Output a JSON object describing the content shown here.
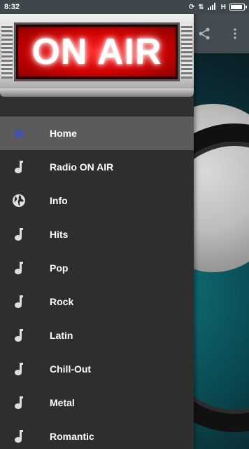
{
  "status_bar": {
    "time": "8:32",
    "network": "H",
    "battery_level": 0.95
  },
  "drawer": {
    "header_sign_text": "ON AIR",
    "items": [
      {
        "label": "Home",
        "icon": "home-icon",
        "active": true
      },
      {
        "label": "Radio ON AIR",
        "icon": "music-note-icon"
      },
      {
        "label": "Info",
        "icon": "globe-icon"
      },
      {
        "label": "Hits",
        "icon": "music-note-icon"
      },
      {
        "label": "Pop",
        "icon": "music-note-icon"
      },
      {
        "label": "Rock",
        "icon": "music-note-icon"
      },
      {
        "label": "Latin",
        "icon": "music-note-icon"
      },
      {
        "label": "Chill-Out",
        "icon": "music-note-icon"
      },
      {
        "label": "Metal",
        "icon": "music-note-icon"
      },
      {
        "label": "Romantic",
        "icon": "music-note-icon"
      }
    ]
  },
  "toolbar": {
    "icons": [
      "share-icon",
      "more-vert-icon"
    ]
  },
  "colors": {
    "drawer_bg": "#2e2e2e",
    "active_item_bg": "#5b5b5b",
    "home_icon": "#3f51b5",
    "sign_red": "#e00000"
  }
}
